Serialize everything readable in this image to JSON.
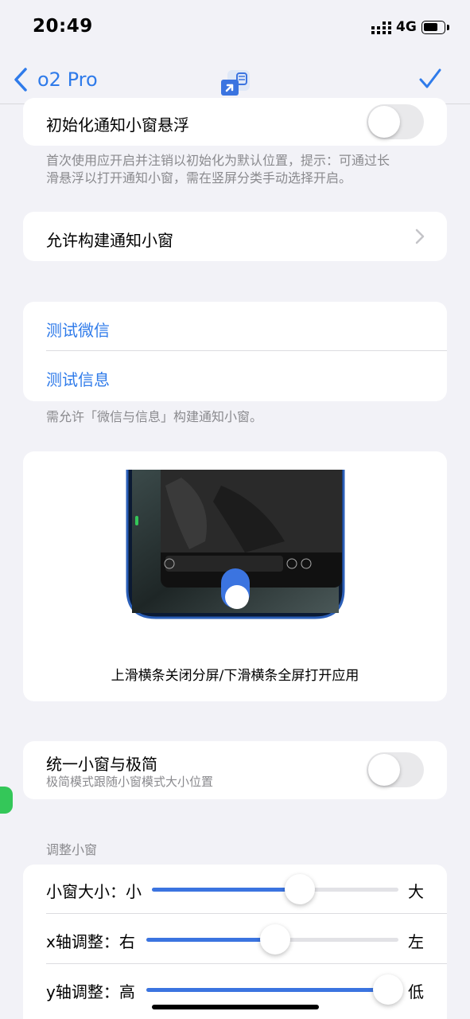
{
  "status": {
    "time": "20:49",
    "network": "4G"
  },
  "nav": {
    "back_label": "o2 Pro",
    "app_icon": "pip-app-icon",
    "confirm_icon": "checkmark-icon"
  },
  "section1": {
    "row_label": "初始化通知小窗悬浮",
    "toggle_on": false,
    "footnote_line1": "首次使用应开启并注销以初始化为默认位置，提示：可通过长",
    "footnote_line2": "滑悬浮以打开通知小窗，需在竖屏分类手动选择开启。"
  },
  "section2": {
    "row_label": "允许构建通知小窗"
  },
  "section3": {
    "test_wechat": "测试微信",
    "test_message": "测试信息",
    "footnote": "需允许「微信与信息」构建通知小窗。"
  },
  "preview": {
    "caption": "上滑横条关闭分屏/下滑横条全屏打开应用"
  },
  "section4": {
    "title": "统一小窗与极简",
    "subtitle": "极简模式跟随小窗模式大小位置",
    "toggle_on": false
  },
  "adjust": {
    "header": "调整小窗",
    "size": {
      "label": "小窗大小：小",
      "end_label": "大",
      "value": 0.6
    },
    "x": {
      "label": "x轴调整：右",
      "end_label": "左",
      "value": 0.51
    },
    "y": {
      "label": "y轴调整：高",
      "end_label": "低",
      "value": 0.96
    }
  },
  "colors": {
    "accent": "#2f7bea",
    "slider": "#3b74e0",
    "float_tab": "#34c759"
  }
}
